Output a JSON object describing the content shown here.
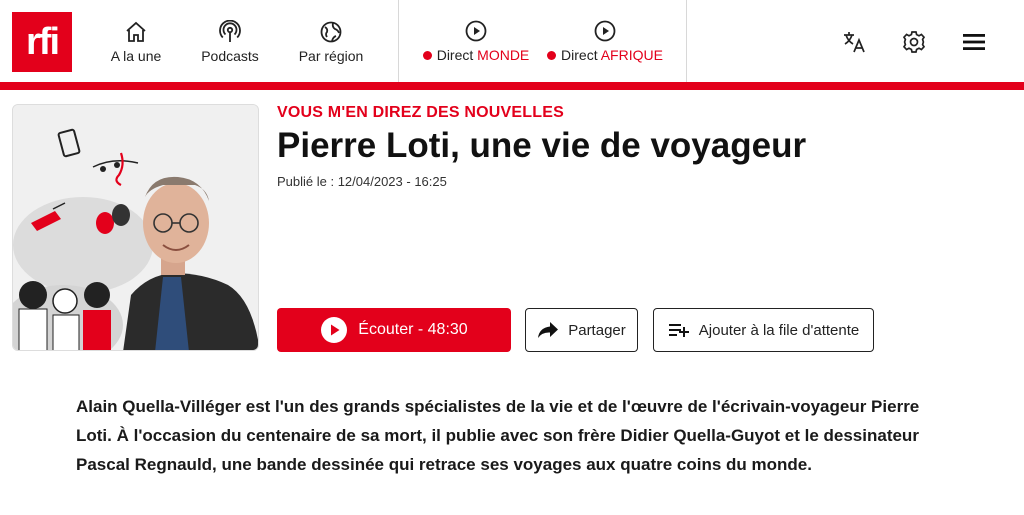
{
  "header": {
    "logo_text": "rfi",
    "nav": [
      {
        "label": "A la une",
        "icon": "home-icon"
      },
      {
        "label": "Podcasts",
        "icon": "podcast-icon"
      },
      {
        "label": "Par région",
        "icon": "globe-icon"
      }
    ],
    "live": [
      {
        "prefix": "Direct",
        "region": "MONDE",
        "icon": "play-circle-icon"
      },
      {
        "prefix": "Direct",
        "region": "AFRIQUE",
        "icon": "play-circle-icon"
      }
    ],
    "tools": [
      "translate-icon",
      "gear-icon",
      "menu-icon"
    ],
    "accent": "#e3001b"
  },
  "episode": {
    "show_name": "VOUS M'EN DIREZ DES NOUVELLES",
    "title": "Pierre Loti, une vie de voyageur",
    "published": "Publié le : 12/04/2023 - 16:25",
    "listen_label": "Écouter - 48:30",
    "share_label": "Partager",
    "queue_label": "Ajouter à la file d'attente",
    "description": "Alain Quella-Villéger est l'un des grands spécialistes de la vie et de l'œuvre de l'écrivain-voyageur Pierre Loti. À l'occasion du centenaire de sa mort, il publie avec son frère Didier Quella-Guyot et le dessinateur Pascal Regnauld, une bande dessinée qui retrace ses voyages aux quatre coins du monde."
  }
}
